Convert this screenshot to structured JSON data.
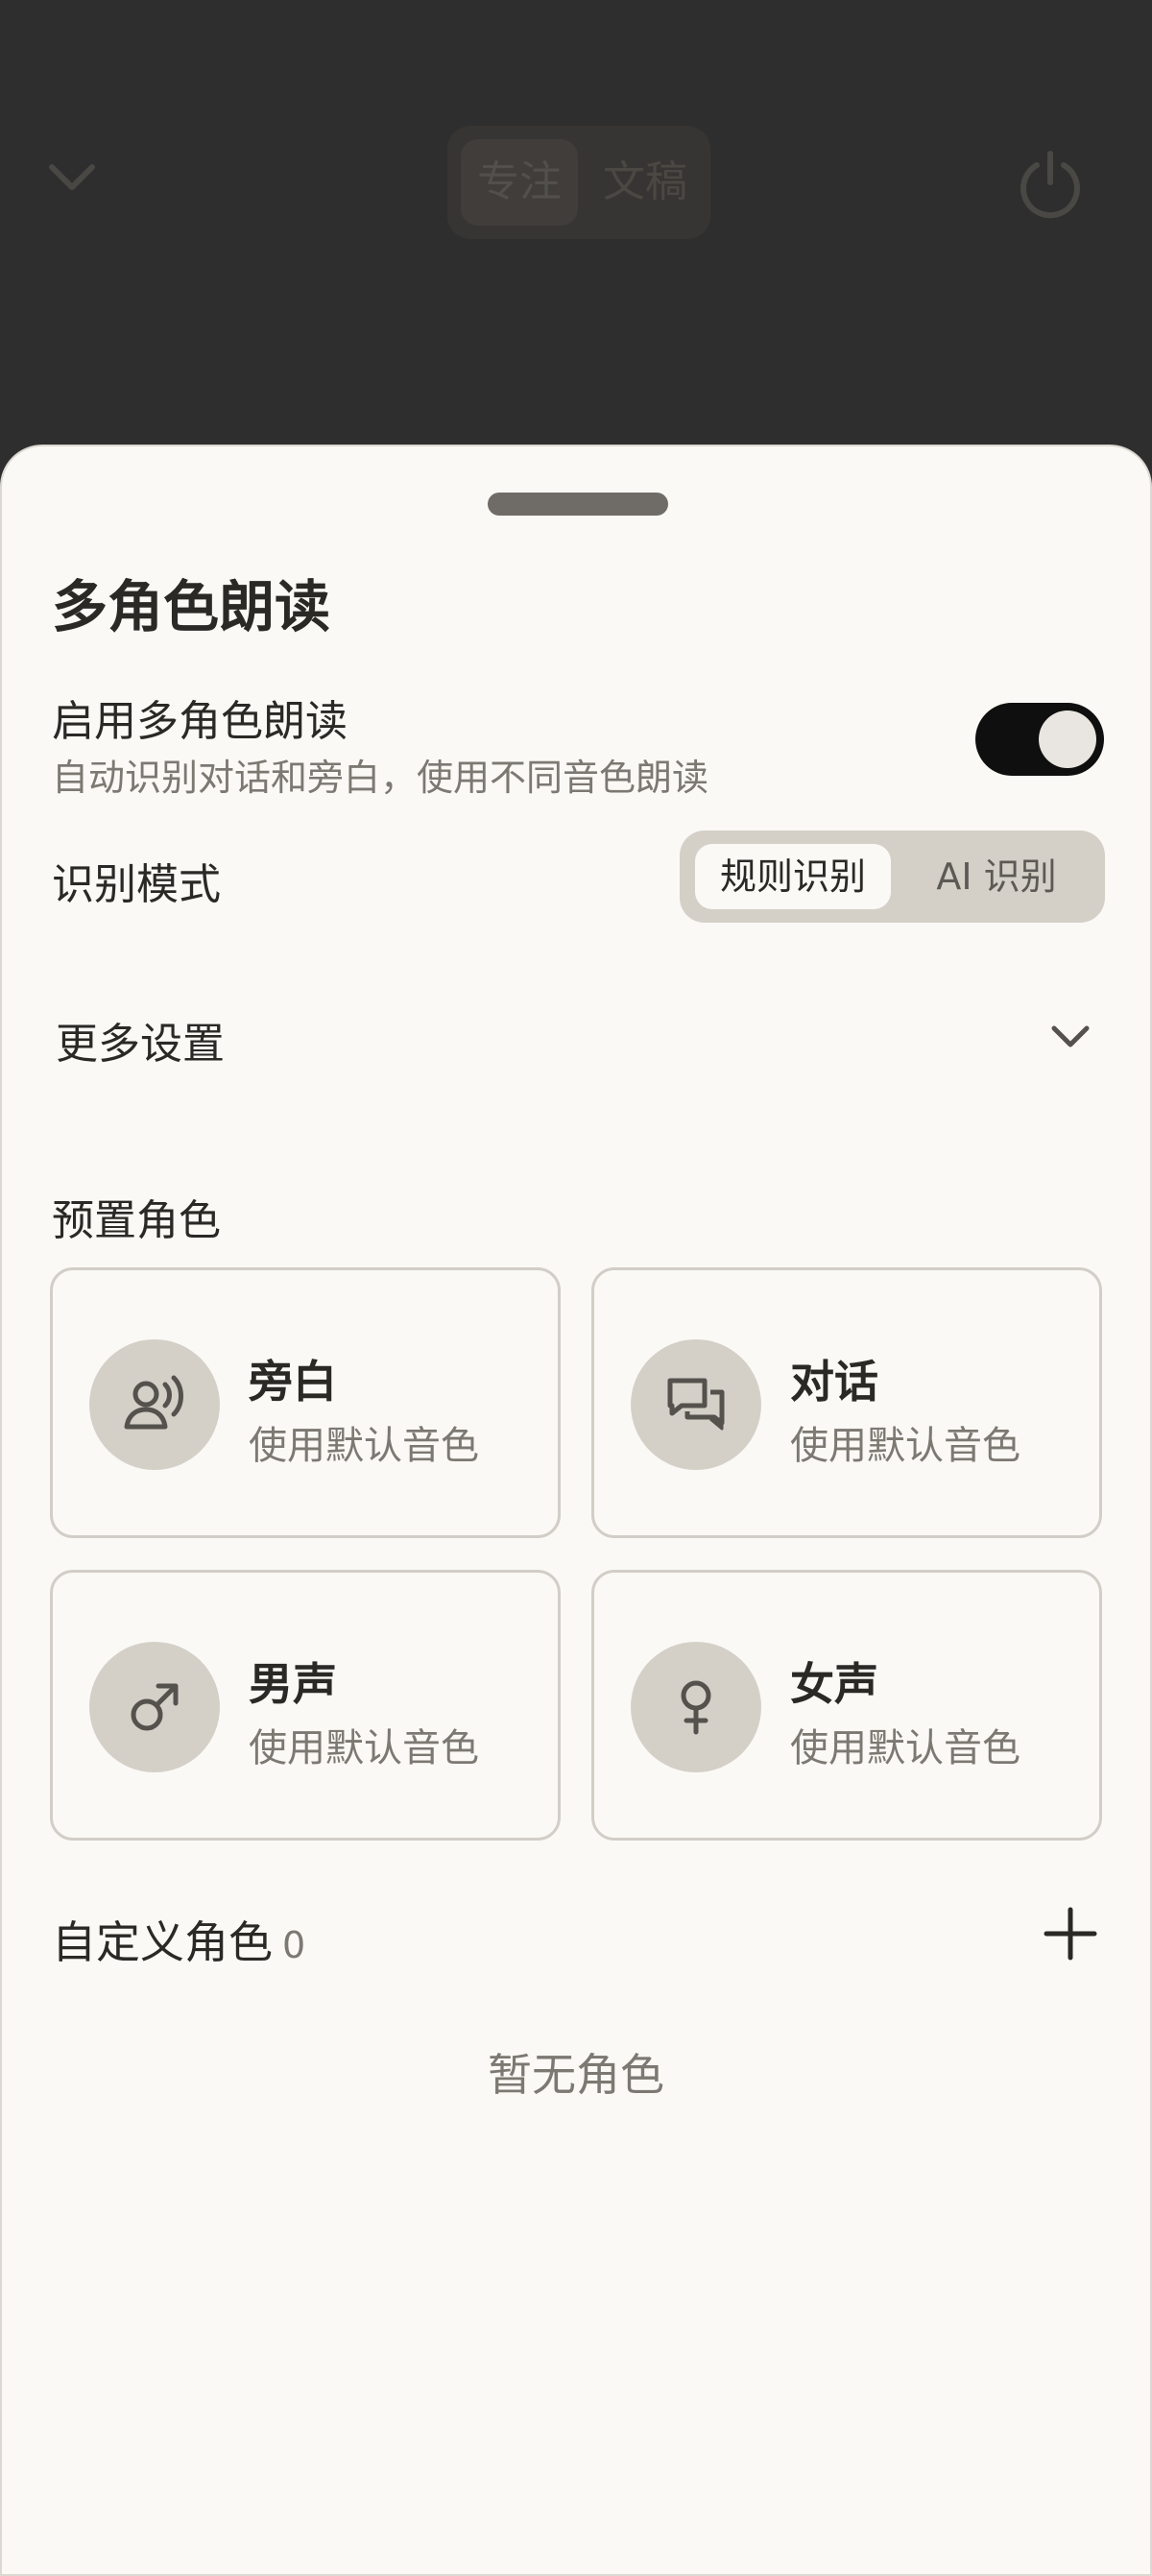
{
  "header": {
    "tabs": [
      {
        "label": "专注",
        "active": true
      },
      {
        "label": "文稿",
        "active": false
      }
    ]
  },
  "sheet": {
    "title": "多角色朗读",
    "enable": {
      "title": "启用多角色朗读",
      "subtitle": "自动识别对话和旁白，使用不同音色朗读",
      "on": true
    },
    "recognition": {
      "label": "识别模式",
      "options": [
        "规则识别",
        "AI 识别"
      ],
      "selected": "规则识别"
    },
    "more_settings": {
      "label": "更多设置"
    },
    "preset": {
      "label": "预置角色",
      "roles": [
        {
          "name": "旁白",
          "sub": "使用默认音色",
          "icon": "narrator-speaking-icon"
        },
        {
          "name": "对话",
          "sub": "使用默认音色",
          "icon": "chat-bubbles-icon"
        },
        {
          "name": "男声",
          "sub": "使用默认音色",
          "icon": "male-symbol-icon"
        },
        {
          "name": "女声",
          "sub": "使用默认音色",
          "icon": "female-symbol-icon"
        }
      ]
    },
    "custom": {
      "label": "自定义角色",
      "count": "0",
      "empty": "暂无角色"
    }
  },
  "colors": {
    "sheet_bg": "#faf9f5",
    "dim_bg": "#2e2e2e",
    "toggle_on": "#0f0f0f",
    "icon_circle": "#d4d0c8"
  }
}
